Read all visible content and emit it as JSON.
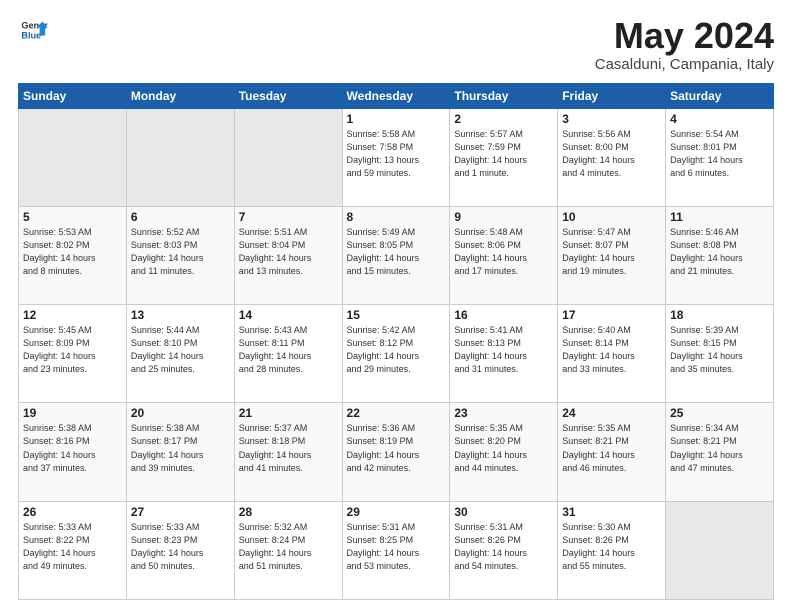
{
  "header": {
    "logo_line1": "General",
    "logo_line2": "Blue",
    "month": "May 2024",
    "location": "Casalduni, Campania, Italy"
  },
  "weekdays": [
    "Sunday",
    "Monday",
    "Tuesday",
    "Wednesday",
    "Thursday",
    "Friday",
    "Saturday"
  ],
  "weeks": [
    [
      {
        "day": "",
        "info": ""
      },
      {
        "day": "",
        "info": ""
      },
      {
        "day": "",
        "info": ""
      },
      {
        "day": "1",
        "info": "Sunrise: 5:58 AM\nSunset: 7:58 PM\nDaylight: 13 hours\nand 59 minutes."
      },
      {
        "day": "2",
        "info": "Sunrise: 5:57 AM\nSunset: 7:59 PM\nDaylight: 14 hours\nand 1 minute."
      },
      {
        "day": "3",
        "info": "Sunrise: 5:56 AM\nSunset: 8:00 PM\nDaylight: 14 hours\nand 4 minutes."
      },
      {
        "day": "4",
        "info": "Sunrise: 5:54 AM\nSunset: 8:01 PM\nDaylight: 14 hours\nand 6 minutes."
      }
    ],
    [
      {
        "day": "5",
        "info": "Sunrise: 5:53 AM\nSunset: 8:02 PM\nDaylight: 14 hours\nand 8 minutes."
      },
      {
        "day": "6",
        "info": "Sunrise: 5:52 AM\nSunset: 8:03 PM\nDaylight: 14 hours\nand 11 minutes."
      },
      {
        "day": "7",
        "info": "Sunrise: 5:51 AM\nSunset: 8:04 PM\nDaylight: 14 hours\nand 13 minutes."
      },
      {
        "day": "8",
        "info": "Sunrise: 5:49 AM\nSunset: 8:05 PM\nDaylight: 14 hours\nand 15 minutes."
      },
      {
        "day": "9",
        "info": "Sunrise: 5:48 AM\nSunset: 8:06 PM\nDaylight: 14 hours\nand 17 minutes."
      },
      {
        "day": "10",
        "info": "Sunrise: 5:47 AM\nSunset: 8:07 PM\nDaylight: 14 hours\nand 19 minutes."
      },
      {
        "day": "11",
        "info": "Sunrise: 5:46 AM\nSunset: 8:08 PM\nDaylight: 14 hours\nand 21 minutes."
      }
    ],
    [
      {
        "day": "12",
        "info": "Sunrise: 5:45 AM\nSunset: 8:09 PM\nDaylight: 14 hours\nand 23 minutes."
      },
      {
        "day": "13",
        "info": "Sunrise: 5:44 AM\nSunset: 8:10 PM\nDaylight: 14 hours\nand 25 minutes."
      },
      {
        "day": "14",
        "info": "Sunrise: 5:43 AM\nSunset: 8:11 PM\nDaylight: 14 hours\nand 28 minutes."
      },
      {
        "day": "15",
        "info": "Sunrise: 5:42 AM\nSunset: 8:12 PM\nDaylight: 14 hours\nand 29 minutes."
      },
      {
        "day": "16",
        "info": "Sunrise: 5:41 AM\nSunset: 8:13 PM\nDaylight: 14 hours\nand 31 minutes."
      },
      {
        "day": "17",
        "info": "Sunrise: 5:40 AM\nSunset: 8:14 PM\nDaylight: 14 hours\nand 33 minutes."
      },
      {
        "day": "18",
        "info": "Sunrise: 5:39 AM\nSunset: 8:15 PM\nDaylight: 14 hours\nand 35 minutes."
      }
    ],
    [
      {
        "day": "19",
        "info": "Sunrise: 5:38 AM\nSunset: 8:16 PM\nDaylight: 14 hours\nand 37 minutes."
      },
      {
        "day": "20",
        "info": "Sunrise: 5:38 AM\nSunset: 8:17 PM\nDaylight: 14 hours\nand 39 minutes."
      },
      {
        "day": "21",
        "info": "Sunrise: 5:37 AM\nSunset: 8:18 PM\nDaylight: 14 hours\nand 41 minutes."
      },
      {
        "day": "22",
        "info": "Sunrise: 5:36 AM\nSunset: 8:19 PM\nDaylight: 14 hours\nand 42 minutes."
      },
      {
        "day": "23",
        "info": "Sunrise: 5:35 AM\nSunset: 8:20 PM\nDaylight: 14 hours\nand 44 minutes."
      },
      {
        "day": "24",
        "info": "Sunrise: 5:35 AM\nSunset: 8:21 PM\nDaylight: 14 hours\nand 46 minutes."
      },
      {
        "day": "25",
        "info": "Sunrise: 5:34 AM\nSunset: 8:21 PM\nDaylight: 14 hours\nand 47 minutes."
      }
    ],
    [
      {
        "day": "26",
        "info": "Sunrise: 5:33 AM\nSunset: 8:22 PM\nDaylight: 14 hours\nand 49 minutes."
      },
      {
        "day": "27",
        "info": "Sunrise: 5:33 AM\nSunset: 8:23 PM\nDaylight: 14 hours\nand 50 minutes."
      },
      {
        "day": "28",
        "info": "Sunrise: 5:32 AM\nSunset: 8:24 PM\nDaylight: 14 hours\nand 51 minutes."
      },
      {
        "day": "29",
        "info": "Sunrise: 5:31 AM\nSunset: 8:25 PM\nDaylight: 14 hours\nand 53 minutes."
      },
      {
        "day": "30",
        "info": "Sunrise: 5:31 AM\nSunset: 8:26 PM\nDaylight: 14 hours\nand 54 minutes."
      },
      {
        "day": "31",
        "info": "Sunrise: 5:30 AM\nSunset: 8:26 PM\nDaylight: 14 hours\nand 55 minutes."
      },
      {
        "day": "",
        "info": ""
      }
    ]
  ]
}
